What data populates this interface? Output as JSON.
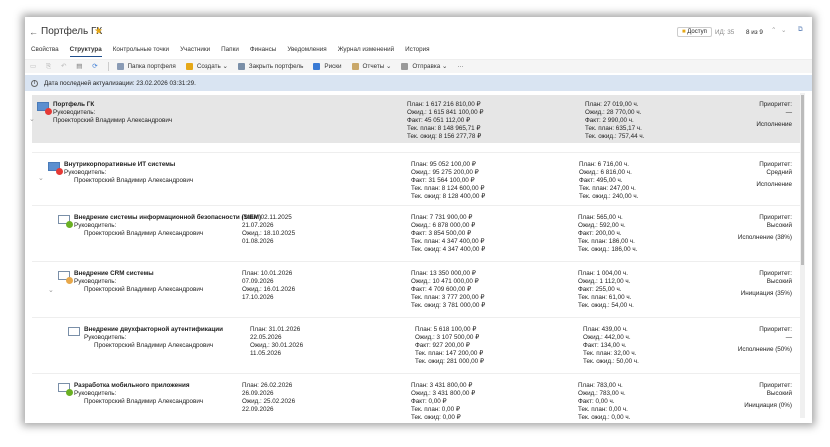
{
  "header": {
    "back": "←",
    "title": "Портфель ГК",
    "access": "Доступ",
    "id": "ИД: 35",
    "counter": "8 из 9"
  },
  "tabs": [
    "Свойства",
    "Структура",
    "Контрольные точки",
    "Участники",
    "Папки",
    "Финансы",
    "Уведомления",
    "Журнал изменений",
    "История"
  ],
  "toolbar": [
    "Папка портфеля",
    "Создать ⌄",
    "Закрыть портфель",
    "Риски",
    "Отчеты ⌄",
    "Отправка ⌄",
    "···"
  ],
  "info": "Дата последней актуализации: 23.02.2026 03:31:29.",
  "colors": {
    "red": "#e53935",
    "green": "#6ab023",
    "orange": "#e8a84a",
    "info_bg": "#d9e4f2"
  },
  "rows": [
    {
      "name": "Портфель ГК",
      "mgr_label": "Руководитель:",
      "mgr": "Проекторский Владимир Александрович",
      "dates": null,
      "money": [
        "План: 1 617 216 810,00 ₽",
        "Ожид.: 1 615 841 100,00 ₽",
        "Факт: 45 051 112,00 ₽",
        "Тек. план: 8 148 965,71 ₽",
        "Тек. ожид: 8 156 277,78 ₽"
      ],
      "hours": [
        "План: 27 019,00 ч.",
        "Ожид.: 28 770,00 ч.",
        "Факт: 2 990,00 ч.",
        "Тек. план: 635,17 ч.",
        "Тек. ожид.: 757,44 ч."
      ],
      "priority_label": "Приоритет:",
      "priority": "—",
      "status": "Исполнение",
      "dot": "red"
    },
    {
      "name": "Внутрикорпоративные ИТ системы",
      "mgr_label": "Руководитель:",
      "mgr": "Проекторский Владимир Александрович",
      "dates": null,
      "money": [
        "План: 95 052 100,00 ₽",
        "Ожид.: 95 275 200,00 ₽",
        "Факт: 31 564 100,00 ₽",
        "Тек. план: 8 124 600,00 ₽",
        "Тек. ожид: 8 128 400,00 ₽"
      ],
      "hours": [
        "План: 6 716,00 ч.",
        "Ожид.: 6 816,00 ч.",
        "Факт: 495,00 ч.",
        "Тек. план: 247,00 ч.",
        "Тек. ожид.: 240,00 ч."
      ],
      "priority_label": "Приоритет:",
      "priority": "Средний",
      "status": "Исполнение",
      "dot": "red"
    },
    {
      "name": "Внедрение системы информационной безопасности (SIEM)",
      "mgr_label": "Руководитель:",
      "mgr": "Проекторский Владимир Александрович",
      "dates": [
        "План: 02.11.2025",
        "21.07.2026",
        "Ожид.: 18.10.2025",
        "01.08.2026"
      ],
      "money": [
        "План: 7 731 900,00 ₽",
        "Ожид.: 6 878 000,00 ₽",
        "Факт: 3 854 500,00 ₽",
        "Тек. план: 4 347 400,00 ₽",
        "Тек. ожид: 4 347 400,00 ₽"
      ],
      "hours": [
        "План: 565,00 ч.",
        "Ожид.: 592,00 ч.",
        "Факт: 200,00 ч.",
        "Тек. план: 186,00 ч.",
        "Тек. ожид.: 186,00 ч."
      ],
      "priority_label": "Приоритет:",
      "priority": "Высокий",
      "status": "Исполнение (38%)",
      "dot": "green"
    },
    {
      "name": "Внедрение CRM системы",
      "mgr_label": "Руководитель:",
      "mgr": "Проекторский Владимир Александрович",
      "dates": [
        "План: 10.01.2026",
        "07.09.2026",
        "Ожид.: 16.01.2026",
        "17.10.2026"
      ],
      "money": [
        "План: 13 350 000,00 ₽",
        "Ожид.: 10 471 000,00 ₽",
        "Факт: 4 709 600,00 ₽",
        "Тек. план: 3 777 200,00 ₽",
        "Тек. ожид: 3 781 000,00 ₽"
      ],
      "hours": [
        "План: 1 004,00 ч.",
        "Ожид.: 1 112,00 ч.",
        "Факт: 255,00 ч.",
        "Тек. план: 61,00 ч.",
        "Тек. ожид.: 54,00 ч."
      ],
      "priority_label": "Приоритет:",
      "priority": "Высокий",
      "status": "Инициация (35%)",
      "dot": "orange"
    },
    {
      "name": "Внедрение двухфакторной аутентификации",
      "mgr_label": "Руководитель:",
      "mgr": "Проекторский Владимир Александрович",
      "dates": [
        "План: 31.01.2026",
        "22.05.2026",
        "Ожид.: 30.01.2026",
        "11.05.2026"
      ],
      "money": [
        "План: 5 618 100,00 ₽",
        "Ожид.: 3 107 500,00 ₽",
        "Факт: 927 200,00 ₽",
        "Тек. план: 147 200,00 ₽",
        "Тек. ожид: 281 000,00 ₽"
      ],
      "hours": [
        "План: 439,00 ч.",
        "Ожид.: 442,00 ч.",
        "Факт: 134,00 ч.",
        "Тек. план: 32,00 ч.",
        "Тек. ожид.: 50,00 ч."
      ],
      "priority_label": "Приоритет:",
      "priority": "—",
      "status": "Исполнение (50%)",
      "dot": null
    },
    {
      "name": "Разработка мобильного приложения",
      "mgr_label": "Руководитель:",
      "mgr": "Проекторский Владимир Александрович",
      "dates": [
        "План: 26.02.2026",
        "26.09.2026",
        "Ожид.: 25.02.2026",
        "22.09.2026"
      ],
      "money": [
        "План: 3 431 800,00 ₽",
        "Ожид.: 3 431 800,00 ₽",
        "Факт: 0,00 ₽",
        "Тек. план: 0,00 ₽",
        "Тек. ожид: 0,00 ₽"
      ],
      "hours": [
        "План: 783,00 ч.",
        "Ожид.: 783,00 ч.",
        "Факт: 0,00 ч.",
        "Тек. план: 0,00 ч.",
        "Тек. ожид.: 0,00 ч."
      ],
      "priority_label": "Приоритет:",
      "priority": "Высокий",
      "status": "Инициация (0%)",
      "dot": "green"
    }
  ]
}
